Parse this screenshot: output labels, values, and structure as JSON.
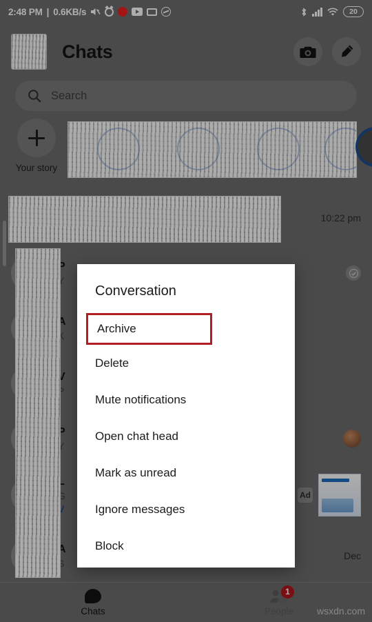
{
  "status_bar": {
    "time": "2:48 PM",
    "separator": "|",
    "network_speed": "0.6KB/s",
    "left_icons": [
      "mute-icon",
      "alarm-icon",
      "recording-icon",
      "youtube-icon",
      "screencast-icon",
      "messenger-icon"
    ],
    "right_icons": [
      "bluetooth-icon",
      "cellular-signal-icon",
      "wifi-icon"
    ],
    "battery_level": "20"
  },
  "header": {
    "title": "Chats",
    "avatar_name": "profile-avatar",
    "camera_label": "Camera",
    "compose_label": "New message"
  },
  "search": {
    "placeholder": "Search",
    "value": ""
  },
  "stories": {
    "your_story_label": "Your story",
    "add_label": "+"
  },
  "chat_list": {
    "rows": [
      {
        "name": "",
        "snippet": "",
        "meta": "10:22 pm",
        "obscured": true
      },
      {
        "name": "P",
        "snippet": "Y",
        "meta": "",
        "obscured": true
      },
      {
        "name": "A",
        "snippet": "K",
        "meta": "",
        "obscured": true
      },
      {
        "name": "V",
        "snippet": "P",
        "meta": "",
        "obscured": true
      },
      {
        "name": "P",
        "snippet": "Y",
        "meta": "",
        "obscured": true
      },
      {
        "name": "L",
        "snippet": "G",
        "snippet2": "V",
        "meta": "",
        "obscured": true
      },
      {
        "name": "A",
        "snippet": "S",
        "meta": "Dec",
        "obscured": true
      }
    ],
    "ad_badge": "Ad"
  },
  "dialog": {
    "title": "Conversation",
    "items": [
      {
        "label": "Archive",
        "highlighted": true
      },
      {
        "label": "Delete",
        "highlighted": false
      },
      {
        "label": "Mute notifications",
        "highlighted": false
      },
      {
        "label": "Open chat head",
        "highlighted": false
      },
      {
        "label": "Mark as unread",
        "highlighted": false
      },
      {
        "label": "Ignore messages",
        "highlighted": false
      },
      {
        "label": "Block",
        "highlighted": false
      }
    ],
    "highlight_color": "#b01e24"
  },
  "bottom_nav": {
    "tabs": [
      {
        "label": "Chats",
        "icon": "chat-bubble-icon",
        "active": true,
        "badge": ""
      },
      {
        "label": "People",
        "icon": "people-icon",
        "active": false,
        "badge": "1"
      }
    ],
    "badge_color": "#b3161d"
  },
  "watermark": "wsxdn.com"
}
